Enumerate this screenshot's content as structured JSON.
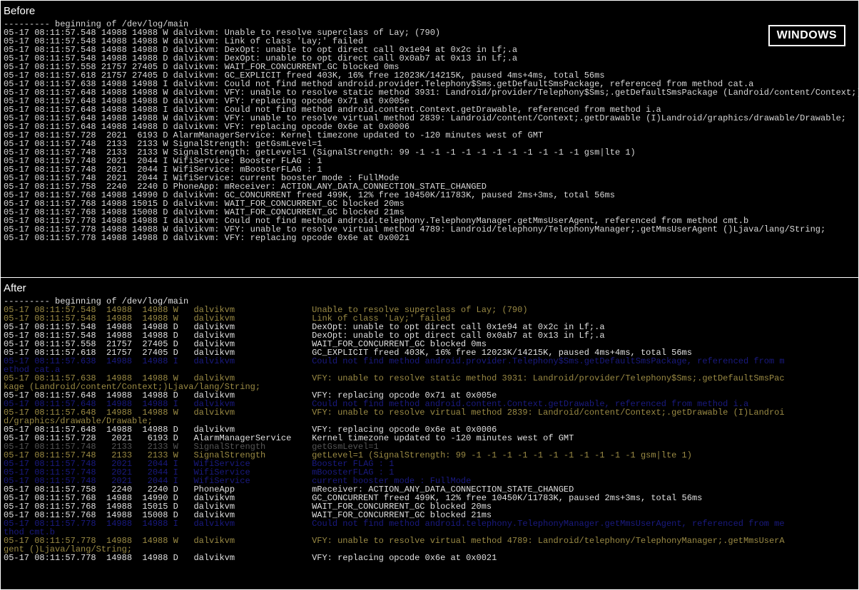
{
  "labels": {
    "before": "Before",
    "after": "After",
    "windows": "WINDOWS"
  },
  "before_lines": [
    "--------- beginning of /dev/log/main",
    "05-17 08:11:57.548 14988 14988 W dalvikvm: Unable to resolve superclass of Lay; (790)",
    "05-17 08:11:57.548 14988 14988 W dalvikvm: Link of class 'Lay;' failed",
    "05-17 08:11:57.548 14988 14988 D dalvikvm: DexOpt: unable to opt direct call 0x1e94 at 0x2c in Lf;.a",
    "05-17 08:11:57.548 14988 14988 D dalvikvm: DexOpt: unable to opt direct call 0x0ab7 at 0x13 in Lf;.a",
    "05-17 08:11:57.558 21757 27405 D dalvikvm: WAIT_FOR_CONCURRENT_GC blocked 0ms",
    "05-17 08:11:57.618 21757 27405 D dalvikvm: GC_EXPLICIT freed 403K, 16% free 12023K/14215K, paused 4ms+4ms, total 56ms",
    "05-17 08:11:57.638 14988 14988 I dalvikvm: Could not find method android.provider.Telephony$Sms.getDefaultSmsPackage, referenced from method cat.a",
    "05-17 08:11:57.648 14988 14988 W dalvikvm: VFY: unable to resolve static method 3931: Landroid/provider/Telephony$Sms;.getDefaultSmsPackage (Landroid/content/Context;)Ljava/lang/String;",
    "05-17 08:11:57.648 14988 14988 D dalvikvm: VFY: replacing opcode 0x71 at 0x005e",
    "05-17 08:11:57.648 14988 14988 I dalvikvm: Could not find method android.content.Context.getDrawable, referenced from method i.a",
    "05-17 08:11:57.648 14988 14988 W dalvikvm: VFY: unable to resolve virtual method 2839: Landroid/content/Context;.getDrawable (I)Landroid/graphics/drawable/Drawable;",
    "05-17 08:11:57.648 14988 14988 D dalvikvm: VFY: replacing opcode 0x6e at 0x0006",
    "05-17 08:11:57.728  2021  6193 D AlarmManagerService: Kernel timezone updated to -120 minutes west of GMT",
    "05-17 08:11:57.748  2133  2133 W SignalStrength: getGsmLevel=1",
    "05-17 08:11:57.748  2133  2133 W SignalStrength: getLevel=1 (SignalStrength: 99 -1 -1 -1 -1 -1 -1 -1 -1 -1 -1 -1 gsm|lte 1)",
    "05-17 08:11:57.748  2021  2044 I WifiService: Booster FLAG : 1",
    "05-17 08:11:57.748  2021  2044 I WifiService: mBoosterFLAG : 1",
    "05-17 08:11:57.748  2021  2044 I WifiService: current booster mode : FullMode",
    "05-17 08:11:57.758  2240  2240 D PhoneApp: mReceiver: ACTION_ANY_DATA_CONNECTION_STATE_CHANGED",
    "05-17 08:11:57.768 14988 14990 D dalvikvm: GC_CONCURRENT freed 499K, 12% free 10450K/11783K, paused 2ms+3ms, total 56ms",
    "05-17 08:11:57.768 14988 15015 D dalvikvm: WAIT_FOR_CONCURRENT_GC blocked 20ms",
    "05-17 08:11:57.768 14988 15008 D dalvikvm: WAIT_FOR_CONCURRENT_GC blocked 21ms",
    "05-17 08:11:57.778 14988 14988 I dalvikvm: Could not find method android.telephony.TelephonyManager.getMmsUserAgent, referenced from method cmt.b",
    "05-17 08:11:57.778 14988 14988 W dalvikvm: VFY: unable to resolve virtual method 4789: Landroid/telephony/TelephonyManager;.getMmsUserAgent ()Ljava/lang/String;",
    "05-17 08:11:57.778 14988 14988 D dalvikvm: VFY: replacing opcode 0x6e at 0x0021"
  ],
  "after_lines": [
    {
      "c": "white",
      "t": "--------- beginning of /dev/log/main"
    },
    {
      "c": "yellow",
      "t": "05-17 08:11:57.548  14988  14988 W   dalvikvm               Unable to resolve superclass of Lay; (790)"
    },
    {
      "c": "yellow",
      "t": "05-17 08:11:57.548  14988  14988 W   dalvikvm               Link of class 'Lay;' failed"
    },
    {
      "c": "white",
      "t": "05-17 08:11:57.548  14988  14988 D   dalvikvm               DexOpt: unable to opt direct call 0x1e94 at 0x2c in Lf;.a"
    },
    {
      "c": "white",
      "t": "05-17 08:11:57.548  14988  14988 D   dalvikvm               DexOpt: unable to opt direct call 0x0ab7 at 0x13 in Lf;.a"
    },
    {
      "c": "white",
      "t": "05-17 08:11:57.558  21757  27405 D   dalvikvm               WAIT_FOR_CONCURRENT_GC blocked 0ms"
    },
    {
      "c": "white",
      "t": "05-17 08:11:57.618  21757  27405 D   dalvikvm               GC_EXPLICIT freed 403K, 16% free 12023K/14215K, paused 4ms+4ms, total 56ms"
    },
    {
      "c": "blue",
      "t": "05-17 08:11:57.638  14988  14988 I   dalvikvm               Could not find method android.provider.Telephony$Sms.getDefaultSmsPackage, referenced from m"
    },
    {
      "c": "blue",
      "t": "ethod cat.a"
    },
    {
      "c": "yellow",
      "t": "05-17 08:11:57.638  14988  14988 W   dalvikvm               VFY: unable to resolve static method 3931: Landroid/provider/Telephony$Sms;.getDefaultSmsPac"
    },
    {
      "c": "yellow",
      "t": "kage (Landroid/content/Context;)Ljava/lang/String;"
    },
    {
      "c": "white",
      "t": "05-17 08:11:57.648  14988  14988 D   dalvikvm               VFY: replacing opcode 0x71 at 0x005e"
    },
    {
      "c": "blue",
      "t": "05-17 08:11:57.648  14988  14988 I   dalvikvm               Could not find method android.content.Context.getDrawable, referenced from method i.a"
    },
    {
      "c": "yellow",
      "t": "05-17 08:11:57.648  14988  14988 W   dalvikvm               VFY: unable to resolve virtual method 2839: Landroid/content/Context;.getDrawable (I)Landroi"
    },
    {
      "c": "yellow",
      "t": "d/graphics/drawable/Drawable;"
    },
    {
      "c": "white",
      "t": "05-17 08:11:57.648  14988  14988 D   dalvikvm               VFY: replacing opcode 0x6e at 0x0006"
    },
    {
      "c": "white",
      "t": "05-17 08:11:57.728   2021   6193 D   AlarmManagerService    Kernel timezone updated to -120 minutes west of GMT"
    },
    {
      "c": "gray",
      "t": "05-17 08:11:57.748   2133   2133 W   SignalStrength         getGsmLevel=1"
    },
    {
      "c": "yellow",
      "t": "05-17 08:11:57.748   2133   2133 W   SignalStrength         getLevel=1 (SignalStrength: 99 -1 -1 -1 -1 -1 -1 -1 -1 -1 -1 -1 gsm|lte 1)"
    },
    {
      "c": "blue",
      "t": "05-17 08:11:57.748   2021   2044 I   WifiService            Booster FLAG : 1"
    },
    {
      "c": "blue",
      "t": "05-17 08:11:57.748   2021   2044 I   WifiService            mBoosterFLAG : 1"
    },
    {
      "c": "blue",
      "t": "05-17 08:11:57.748   2021   2044 I   WifiService            current booster mode : FullMode"
    },
    {
      "c": "white",
      "t": "05-17 08:11:57.758   2240   2240 D   PhoneApp               mReceiver: ACTION_ANY_DATA_CONNECTION_STATE_CHANGED"
    },
    {
      "c": "white",
      "t": "05-17 08:11:57.768  14988  14990 D   dalvikvm               GC_CONCURRENT freed 499K, 12% free 10450K/11783K, paused 2ms+3ms, total 56ms"
    },
    {
      "c": "white",
      "t": "05-17 08:11:57.768  14988  15015 D   dalvikvm               WAIT_FOR_CONCURRENT_GC blocked 20ms"
    },
    {
      "c": "white",
      "t": "05-17 08:11:57.768  14988  15008 D   dalvikvm               WAIT_FOR_CONCURRENT_GC blocked 21ms"
    },
    {
      "c": "blue",
      "t": "05-17 08:11:57.778  14988  14988 I   dalvikvm               Could not find method android.telephony.TelephonyManager.getMmsUserAgent, referenced from me"
    },
    {
      "c": "blue",
      "t": "thod cmt.b"
    },
    {
      "c": "yellow",
      "t": "05-17 08:11:57.778  14988  14988 W   dalvikvm               VFY: unable to resolve virtual method 4789: Landroid/telephony/TelephonyManager;.getMmsUserA"
    },
    {
      "c": "yellow",
      "t": "gent ()Ljava/lang/String;"
    },
    {
      "c": "white",
      "t": "05-17 08:11:57.778  14988  14988 D   dalvikvm               VFY: replacing opcode 0x6e at 0x0021"
    }
  ]
}
